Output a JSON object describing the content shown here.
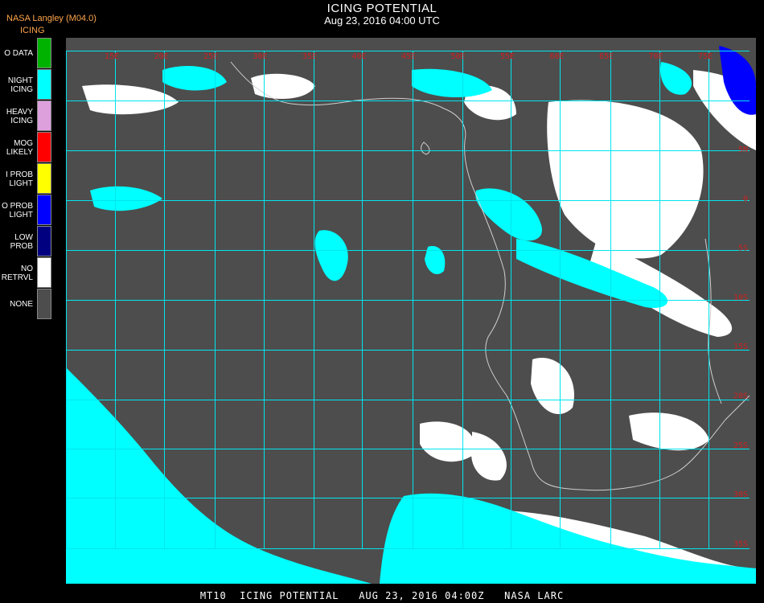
{
  "header": {
    "agency": "NASA Langley (M04.0)",
    "product": "ICING",
    "title": "ICING POTENTIAL",
    "datetime": "Aug 23, 2016 04:00 UTC"
  },
  "legend": {
    "items": [
      {
        "lines": [
          "O DATA"
        ],
        "color": "#00b200"
      },
      {
        "lines": [
          "NIGHT",
          "ICING"
        ],
        "color": "#00ffff"
      },
      {
        "lines": [
          "HEAVY",
          "ICING"
        ],
        "color": "#dda0dd"
      },
      {
        "lines": [
          "MOG",
          "LIKELY"
        ],
        "color": "#ff0000"
      },
      {
        "lines": [
          "I PROB",
          "LIGHT"
        ],
        "color": "#ffff00"
      },
      {
        "lines": [
          "O PROB",
          "LIGHT"
        ],
        "color": "#0000ff"
      },
      {
        "lines": [
          "LOW",
          "PROB"
        ],
        "color": "#000080"
      },
      {
        "lines": [
          "NO",
          "RETRVL"
        ],
        "color": "#ffffff"
      },
      {
        "lines": [
          "NONE"
        ],
        "color": "#4d4d4d"
      }
    ]
  },
  "map": {
    "background_color": "#4d4d4d",
    "grid_color": "#00e5ee",
    "coast_color": "#cfcfcf",
    "night_icing_color": "#00ffff",
    "no_retrieval_color": "#ffffff",
    "light_prob_color": "#0000ff",
    "label_color": "#cc2222",
    "top_labels": [
      "15E",
      "20E",
      "25E",
      "30E",
      "35E",
      "40E",
      "45E",
      "50E",
      "55E",
      "60E",
      "65E",
      "70E",
      "75E"
    ],
    "right_labels": [
      "5N",
      "0",
      "5S",
      "10S",
      "15S",
      "20S",
      "25S",
      "30S",
      "35S",
      "40S"
    ]
  },
  "footer": "MT10  ICING POTENTIAL   AUG 23, 2016 04:00Z   NASA LARC"
}
